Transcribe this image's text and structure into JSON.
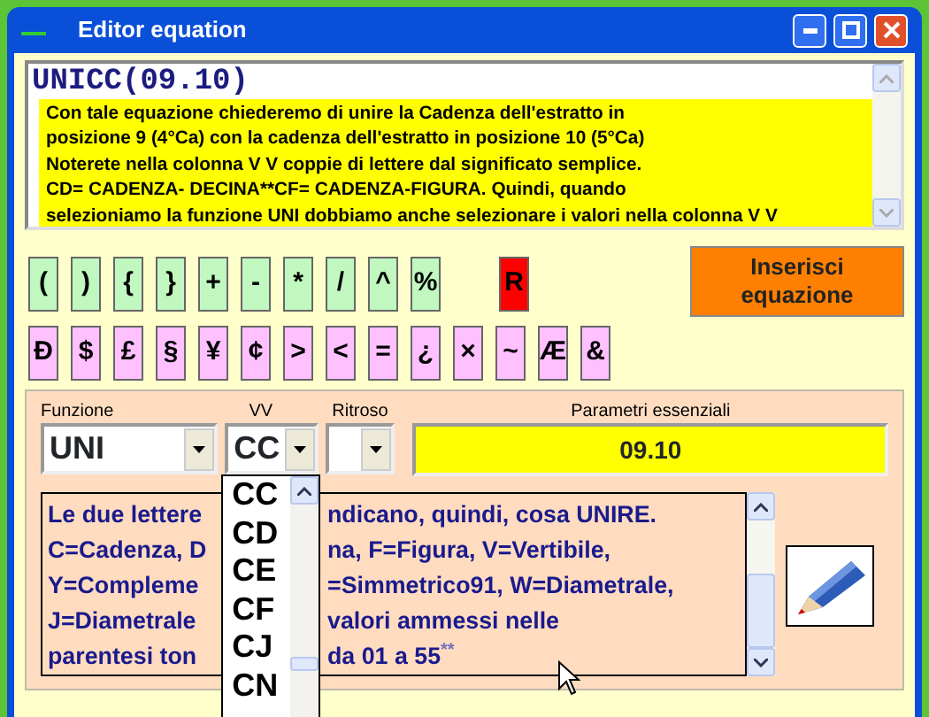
{
  "window": {
    "title": "Editor equation"
  },
  "editor": {
    "formula": "UNICC(09.10)",
    "note_lines": [
      "Con tale equazione chiederemo di unire la Cadenza dell'estratto in",
      "posizione 9 (4°Ca) con la cadenza dell'estratto in posizione 10 (5°Ca)",
      "Noterete nella colonna V V  coppie di lettere dal significato semplice.",
      "CD= CADENZA- DECINA**CF= CADENZA-FIGURA. Quindi, quando",
      "selezioniamo la funzione UNI dobbiamo anche selezionare i valori nella colonna V V"
    ]
  },
  "symbol_rows": [
    [
      {
        "label": "(",
        "kind": "operator"
      },
      {
        "label": ")",
        "kind": "operator"
      },
      {
        "label": "{",
        "kind": "operator"
      },
      {
        "label": "}",
        "kind": "operator"
      },
      {
        "label": "+",
        "kind": "operator"
      },
      {
        "label": "-",
        "kind": "operator"
      },
      {
        "label": "*",
        "kind": "operator"
      },
      {
        "label": "/",
        "kind": "operator"
      },
      {
        "label": "^",
        "kind": "operator"
      },
      {
        "label": "%",
        "kind": "operator"
      },
      {
        "label": "R",
        "kind": "reset"
      }
    ],
    [
      {
        "label": "Đ",
        "kind": "symbol"
      },
      {
        "label": "$",
        "kind": "symbol"
      },
      {
        "label": "£",
        "kind": "symbol"
      },
      {
        "label": "§",
        "kind": "symbol"
      },
      {
        "label": "¥",
        "kind": "symbol"
      },
      {
        "label": "¢",
        "kind": "symbol"
      },
      {
        "label": ">",
        "kind": "symbol"
      },
      {
        "label": "<",
        "kind": "symbol"
      },
      {
        "label": "=",
        "kind": "symbol"
      },
      {
        "label": "¿",
        "kind": "symbol"
      },
      {
        "label": "×",
        "kind": "symbol"
      },
      {
        "label": "~",
        "kind": "symbol"
      },
      {
        "label": "Æ",
        "kind": "symbol"
      },
      {
        "label": "&",
        "kind": "symbol"
      }
    ]
  ],
  "insert_button": "Inserisci equazione",
  "funzione": {
    "label": "Funzione",
    "value": "UNI"
  },
  "vv": {
    "label": "VV",
    "value": "CC",
    "expanded": true,
    "options": [
      "CC",
      "CD",
      "CE",
      "CF",
      "CJ",
      "CN"
    ]
  },
  "ritroso": {
    "label": "Ritroso"
  },
  "parametri": {
    "label": "Parametri essenziali",
    "value": "09.10"
  },
  "description_lines": [
    {
      "left": "Le due lettere",
      "right": "ndicano, quindi, cosa UNIRE."
    },
    {
      "left": "C=Cadenza, D",
      "right": "na, F=Figura, V=Vertibile,"
    },
    {
      "left": "Y=Compleme",
      "right": "=Simmetrico91, W=Diametrale,"
    },
    {
      "left": "J=Diametrale",
      "right": "valori ammessi  nelle"
    },
    {
      "left": "parentesi ton",
      "right": "da 01 a 55$^{**}$"
    }
  ]
}
